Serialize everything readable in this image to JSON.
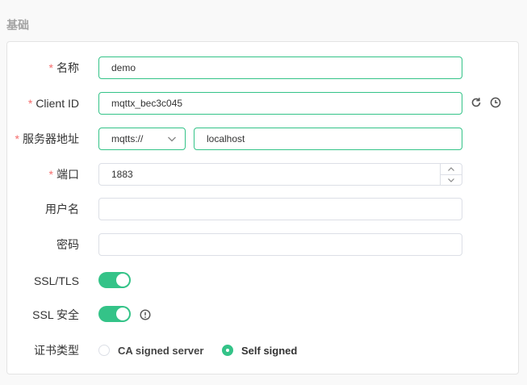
{
  "section": {
    "title": "基础"
  },
  "colors": {
    "accent": "#34c388",
    "required": "#f56c6c"
  },
  "form": {
    "name": {
      "label": "名称",
      "required": true,
      "value": "demo"
    },
    "client_id": {
      "label": "Client ID",
      "required": true,
      "value": "mqttx_bec3c045",
      "actions": [
        "refresh-icon",
        "clock-icon"
      ]
    },
    "server": {
      "label": "服务器地址",
      "required": true,
      "protocol": "mqtts://",
      "host": "localhost"
    },
    "port": {
      "label": "端口",
      "required": true,
      "value": "1883"
    },
    "username": {
      "label": "用户名",
      "required": false,
      "value": ""
    },
    "password": {
      "label": "密码",
      "required": false,
      "value": ""
    },
    "ssl_tls": {
      "label": "SSL/TLS",
      "enabled": true
    },
    "ssl_secure": {
      "label": "SSL 安全",
      "enabled": true,
      "info_icon": "info-circle-icon"
    },
    "cert_type": {
      "label": "证书类型",
      "options": [
        "CA signed server",
        "Self signed"
      ],
      "selected": "Self signed"
    }
  },
  "required_mark": "*"
}
